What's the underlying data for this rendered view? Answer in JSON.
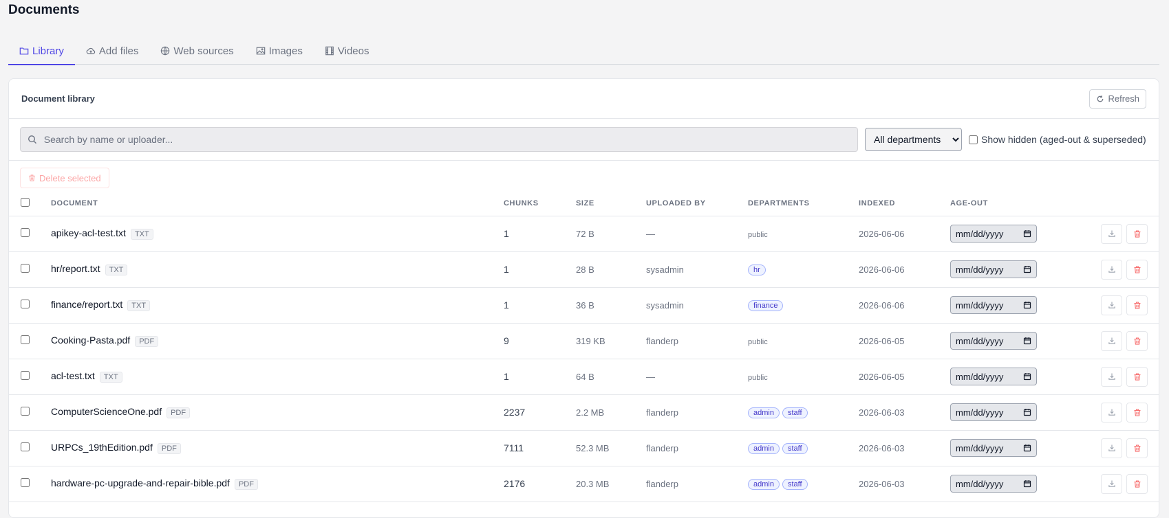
{
  "page": {
    "title": "Documents"
  },
  "tabs": [
    {
      "label": "Library",
      "icon": "folder-icon",
      "active": true
    },
    {
      "label": "Add files",
      "icon": "cloud-upload-icon",
      "active": false
    },
    {
      "label": "Web sources",
      "icon": "globe-icon",
      "active": false
    },
    {
      "label": "Images",
      "icon": "image-icon",
      "active": false
    },
    {
      "label": "Videos",
      "icon": "film-icon",
      "active": false
    }
  ],
  "library": {
    "title": "Document library",
    "refresh_label": "Refresh",
    "search_placeholder": "Search by name or uploader...",
    "department_filter": "All departments",
    "show_hidden_label": "Show hidden (aged-out & superseded)",
    "delete_selected_label": "Delete selected"
  },
  "table": {
    "headers": {
      "document": "DOCUMENT",
      "chunks": "CHUNKS",
      "size": "SIZE",
      "uploaded_by": "UPLOADED BY",
      "departments": "DEPARTMENTS",
      "indexed": "INDEXED",
      "age_out": "AGE-OUT"
    },
    "date_placeholder": "mm/dd/yyyy",
    "rows": [
      {
        "name": "apikey-acl-test.txt",
        "type": "TXT",
        "chunks": "1",
        "size": "72 B",
        "uploaded_by": "—",
        "public": "public",
        "departments": [],
        "indexed": "2026-06-06"
      },
      {
        "name": "hr/report.txt",
        "type": "TXT",
        "chunks": "1",
        "size": "28 B",
        "uploaded_by": "sysadmin",
        "public": "",
        "departments": [
          "hr"
        ],
        "indexed": "2026-06-06"
      },
      {
        "name": "finance/report.txt",
        "type": "TXT",
        "chunks": "1",
        "size": "36 B",
        "uploaded_by": "sysadmin",
        "public": "",
        "departments": [
          "finance"
        ],
        "indexed": "2026-06-06"
      },
      {
        "name": "Cooking-Pasta.pdf",
        "type": "PDF",
        "chunks": "9",
        "size": "319 KB",
        "uploaded_by": "flanderp",
        "public": "public",
        "departments": [],
        "indexed": "2026-06-05"
      },
      {
        "name": "acl-test.txt",
        "type": "TXT",
        "chunks": "1",
        "size": "64 B",
        "uploaded_by": "—",
        "public": "public",
        "departments": [],
        "indexed": "2026-06-05"
      },
      {
        "name": "ComputerScienceOne.pdf",
        "type": "PDF",
        "chunks": "2237",
        "size": "2.2 MB",
        "uploaded_by": "flanderp",
        "public": "",
        "departments": [
          "admin",
          "staff"
        ],
        "indexed": "2026-06-03"
      },
      {
        "name": "URPCs_19thEdition.pdf",
        "type": "PDF",
        "chunks": "7111",
        "size": "52.3 MB",
        "uploaded_by": "flanderp",
        "public": "",
        "departments": [
          "admin",
          "staff"
        ],
        "indexed": "2026-06-03"
      },
      {
        "name": "hardware-pc-upgrade-and-repair-bible.pdf",
        "type": "PDF",
        "chunks": "2176",
        "size": "20.3 MB",
        "uploaded_by": "flanderp",
        "public": "",
        "departments": [
          "admin",
          "staff"
        ],
        "indexed": "2026-06-03"
      }
    ]
  },
  "colors": {
    "accent": "#4f46e5",
    "danger": "#f87171",
    "badge_bg": "#eef2ff"
  }
}
